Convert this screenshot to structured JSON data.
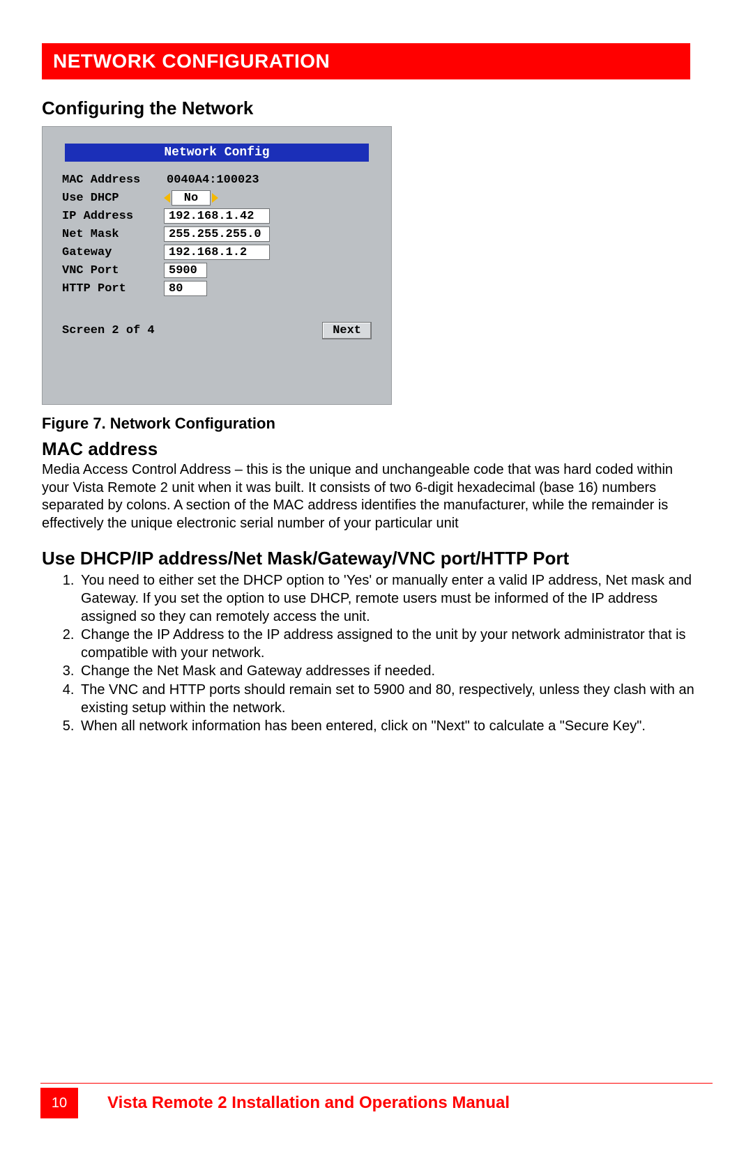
{
  "banner": "NETWORK CONFIGURATION",
  "h2": "Configuring the Network",
  "shot": {
    "title": "Network Config",
    "rows": {
      "mac_label": "MAC Address",
      "mac_value": "0040A4:100023",
      "dhcp_label": "Use DHCP",
      "dhcp_value": "No",
      "ip_label": "IP Address",
      "ip_value": "192.168.1.42",
      "mask_label": "Net Mask",
      "mask_value": "255.255.255.0",
      "gw_label": "Gateway",
      "gw_value": "192.168.1.2",
      "vnc_label": "VNC Port",
      "vnc_value": "5900",
      "http_label": "HTTP Port",
      "http_value": "80"
    },
    "screen": "Screen 2 of 4",
    "next": "Next"
  },
  "caption": "Figure 7. Network Configuration",
  "mac_h": "MAC address",
  "mac_p": "Media Access Control Address – this is the unique and unchangeable code that was hard coded within your Vista Remote 2 unit when it was built. It consists of two 6-digit hexadecimal (base 16) numbers separated by colons. A section of the MAC address identifies the manufacturer, while the remainder is effectively the unique electronic serial number of your particular unit",
  "dhcp_h": "Use DHCP/IP address/Net Mask/Gateway/VNC port/HTTP Port",
  "list": {
    "i1": "You need to either set the DHCP option to 'Yes' or manually enter a valid IP address, Net mask and Gateway.   If you set the option to use DHCP, remote users must be informed of the IP address assigned so they can remotely access the unit.",
    "i2": "Change the IP Address to the IP address assigned to the unit by your network administrator that is compatible with your network.",
    "i3": "Change the Net Mask and Gateway addresses if needed.",
    "i4": "The VNC and HTTP ports should remain set to 5900 and 80, respectively, unless they clash with an existing setup within the network.",
    "i5": "When all network information has been entered, click on \"Next\" to calculate a \"Secure Key\"."
  },
  "footer": {
    "page": "10",
    "title": "Vista Remote 2 Installation and Operations Manual"
  }
}
